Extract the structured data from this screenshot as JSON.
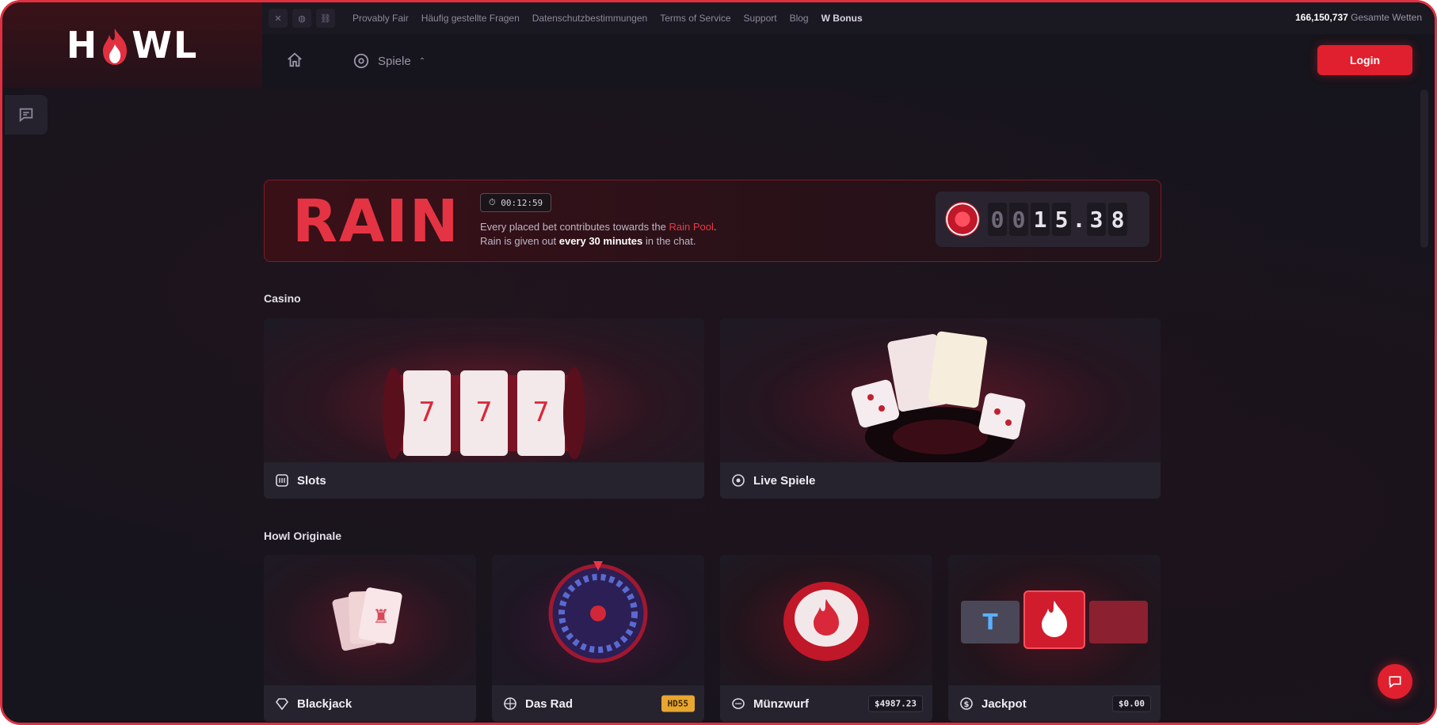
{
  "brand": {
    "logo_left": "H",
    "logo_right": "WL"
  },
  "topbar": {
    "social": [
      "x-icon",
      "discord-icon",
      "link-icon"
    ],
    "links": [
      "Provably Fair",
      "Häufig gestellte Fragen",
      "Datenschutzbestimmungen",
      "Terms of Service",
      "Support",
      "Blog"
    ],
    "bonus": "Bonus",
    "wager_count": "166,150,737",
    "wager_label": "Gesamte Wetten"
  },
  "nav": {
    "games_label": "Spiele",
    "login_label": "Login"
  },
  "rain": {
    "title": "RAIN",
    "timer": "00:12:59",
    "line1_prefix": "Every placed bet contributes towards the ",
    "line1_link": "Rain Pool",
    "line1_suffix": ".",
    "line2_prefix": "Rain is given out ",
    "line2_bold": "every 30 minutes",
    "line2_suffix": " in the chat.",
    "pot_digits": [
      "0",
      "0",
      "1",
      "5",
      ".",
      "3",
      "8"
    ]
  },
  "sections": {
    "casino": "Casino",
    "originals": "Howl Originale"
  },
  "casino_cards": [
    {
      "label": "Slots"
    },
    {
      "label": "Live Spiele"
    }
  ],
  "original_cards": [
    {
      "label": "Blackjack",
      "badge": ""
    },
    {
      "label": "Das Rad",
      "badge": "HD55"
    },
    {
      "label": "Münzwurf",
      "badge": "$4987.23"
    },
    {
      "label": "Jackpot",
      "badge": "$0.00"
    }
  ],
  "colors": {
    "accent": "#e0202e",
    "bg": "#16141d",
    "card": "#26232e"
  }
}
